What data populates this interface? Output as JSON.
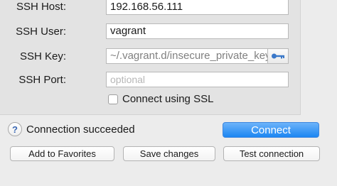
{
  "form": {
    "host": {
      "label": "SSH Host:",
      "value": "192.168.56.111"
    },
    "user": {
      "label": "SSH User:",
      "value": "vagrant"
    },
    "key": {
      "label": "SSH Key:",
      "value": "~/.vagrant.d/insecure_private_key"
    },
    "port": {
      "label": "SSH Port:",
      "value": "",
      "placeholder": "optional"
    },
    "ssl": {
      "label": "Connect using SSL",
      "checked": false
    }
  },
  "status": {
    "icon": "help-icon",
    "text": "Connection succeeded"
  },
  "buttons": {
    "connect": "Connect",
    "add_favorites": "Add to Favorites",
    "save_changes": "Save changes",
    "test_connection": "Test connection"
  },
  "colors": {
    "accent": "#1c86f2",
    "key_icon": "#3a78c9"
  }
}
